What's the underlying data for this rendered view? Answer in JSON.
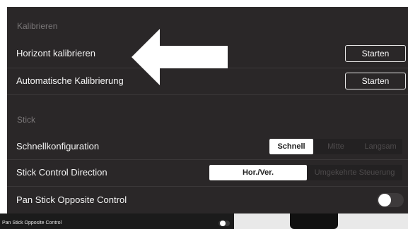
{
  "calibrate": {
    "header": "Kalibrieren",
    "horizon_label": "Horizont kalibrieren",
    "horizon_button": "Starten",
    "auto_label": "Automatische Kalibrierung",
    "auto_button": "Starten"
  },
  "stick": {
    "header": "Stick",
    "quick_config_label": "Schnellkonfiguration",
    "quick_config_options": [
      "Schnell",
      "Mitte",
      "Langsam"
    ],
    "quick_config_selected": "Schnell",
    "direction_label": "Stick Control Direction",
    "direction_options": [
      "Hor./Ver.",
      "Umgekehrte Steuerung"
    ],
    "direction_selected": "Hor./Ver.",
    "pan_label": "Pan Stick Opposite Control",
    "pan_toggle_on": false
  },
  "background_strip": {
    "label": "Pan Stick Opposite Control"
  },
  "annotation": {
    "arrow_color": "#ffffff",
    "icon": "left-arrow-icon"
  }
}
